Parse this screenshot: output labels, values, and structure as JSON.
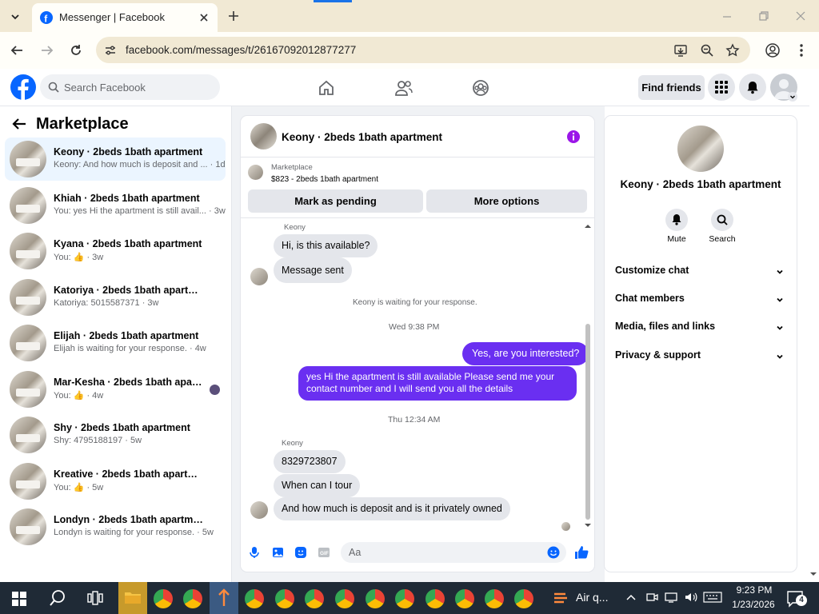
{
  "browser": {
    "tab_title": "Messenger | Facebook",
    "url": "facebook.com/messages/t/26167092012877277"
  },
  "fb": {
    "search_placeholder": "Search Facebook",
    "find_friends": "Find friends"
  },
  "marketplace": {
    "title": "Marketplace",
    "conversations": [
      {
        "name": "Keony · 2beds 1bath apartment",
        "preview": "Keony: And how much is deposit and ... · 1d",
        "selected": true
      },
      {
        "name": "Khiah · 2beds 1bath apartment",
        "preview": "You: yes Hi the apartment is still avail... · 3w"
      },
      {
        "name": "Kyana · 2beds 1bath apartment",
        "preview_prefix": "You:",
        "preview_suffix": "· 3w",
        "thumb": true
      },
      {
        "name": "Katoriya · 2beds 1bath apartment",
        "preview": "Katoriya: 5015587371 · 3w"
      },
      {
        "name": "Elijah · 2beds 1bath apartment",
        "preview": "Elijah is waiting for your response. · 4w"
      },
      {
        "name": "Mar-Kesha · 2beds 1bath apartm...",
        "preview_prefix": "You:",
        "preview_suffix": "· 4w",
        "thumb": true
      },
      {
        "name": "Shy · 2beds 1bath apartment",
        "preview": "Shy: 4795188197 · 5w"
      },
      {
        "name": "Kreative · 2beds 1bath apartment",
        "preview_prefix": "You:",
        "preview_suffix": "· 5w",
        "thumb": true
      },
      {
        "name": "Londyn · 2beds 1bath apartment",
        "preview": "Londyn is waiting for your response. · 5w"
      }
    ]
  },
  "chat": {
    "header_title": "Keony · 2beds 1bath apartment",
    "listing_label": "Marketplace",
    "listing_detail": "$823 - 2beds 1bath apartment",
    "mark_pending": "Mark as pending",
    "more_options": "More options",
    "sender_name": "Keony",
    "messages_in_1": [
      "Hi, is this available?",
      "Message sent"
    ],
    "waiting_note": "Keony is waiting for your response.",
    "time_1": "Wed 9:38 PM",
    "out_1": "Yes, are you interested?",
    "out_2_line1": "yes Hi the apartment is still available Please send me your",
    "out_2_line2": "contact number and I will send you all the details",
    "time_2": "Thu 12:34 AM",
    "sender_name_2": "Keony",
    "messages_in_2": [
      "8329723807",
      "When can I tour",
      "And how much is deposit and is it privately owned"
    ],
    "composer_placeholder": "Aa"
  },
  "details": {
    "title": "Keony · 2beds 1bath apartment",
    "mute": "Mute",
    "search": "Search",
    "sections": [
      "Customize chat",
      "Chat members",
      "Media, files and links",
      "Privacy & support"
    ]
  },
  "taskbar": {
    "air_label": "Air q...",
    "time": "9:23 PM",
    "date": "1/23/2026",
    "notif_count": "4"
  },
  "colors": {
    "accent": "#6a2ff1",
    "fb_blue": "#0866ff"
  }
}
